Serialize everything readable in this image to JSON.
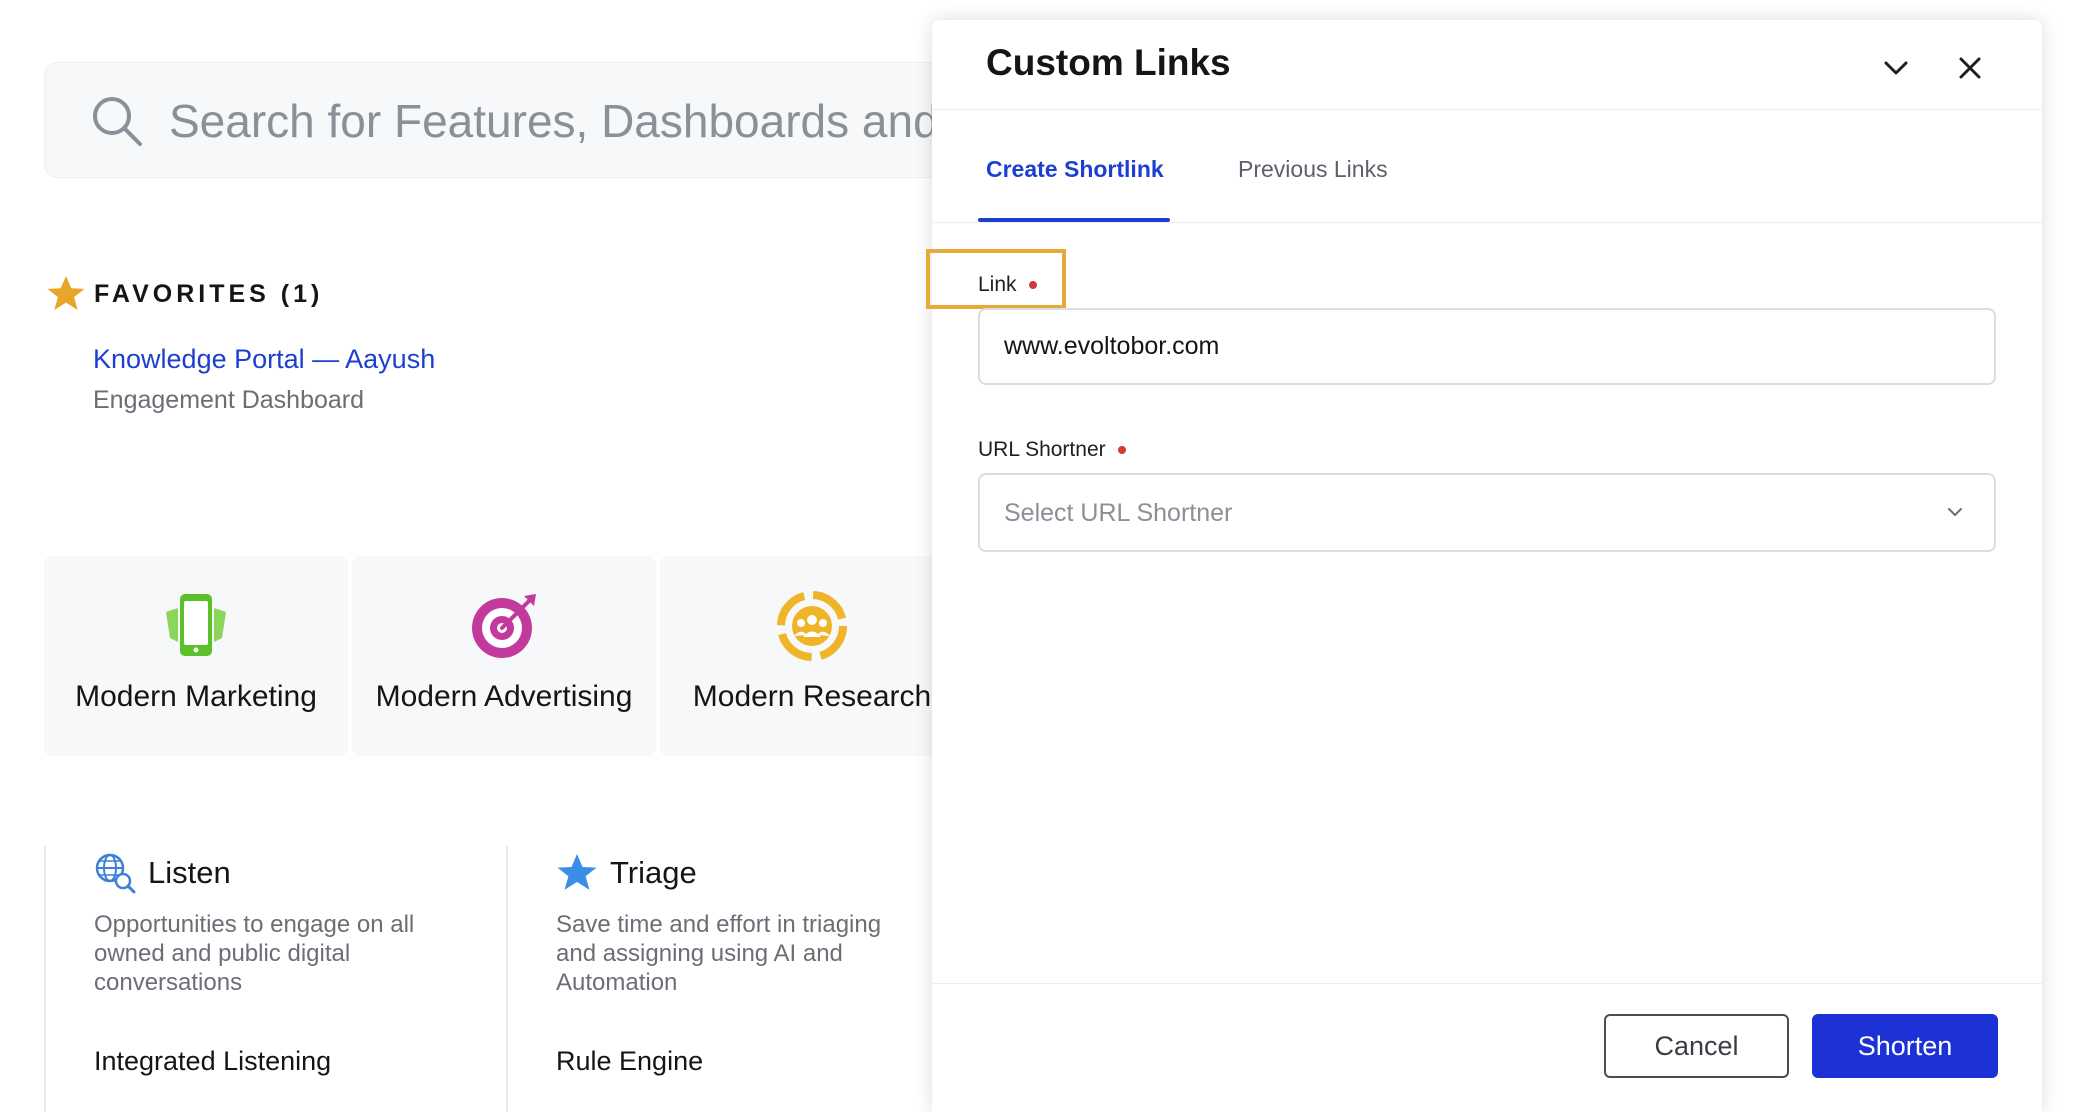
{
  "search": {
    "placeholder": "Search for Features, Dashboards and m"
  },
  "favorites": {
    "title": "FAVORITES (1)",
    "items": [
      {
        "name": "Knowledge Portal — Aayush",
        "subtitle": "Engagement Dashboard"
      }
    ]
  },
  "modules": [
    {
      "label": "Modern Marketing",
      "icon": "phone-icon"
    },
    {
      "label": "Modern Advertising",
      "icon": "target-icon"
    },
    {
      "label": "Modern Research",
      "icon": "research-icon"
    }
  ],
  "features": [
    {
      "title": "Listen",
      "icon": "globe-search-icon",
      "description": "Opportunities to engage on all owned and public digital conversations",
      "link": "Integrated Listening"
    },
    {
      "title": "Triage",
      "icon": "star-icon",
      "description": "Save time and effort in triaging and assigning using AI and Automation",
      "link": "Rule Engine"
    }
  ],
  "panel": {
    "title": "Custom Links",
    "tabs": [
      {
        "label": "Create Shortlink",
        "active": true
      },
      {
        "label": "Previous Links",
        "active": false
      }
    ],
    "link_field": {
      "label": "Link",
      "value": "www.evoltobor.com"
    },
    "shortner_field": {
      "label": "URL Shortner",
      "placeholder": "Select URL Shortner"
    },
    "cancel_label": "Cancel",
    "shorten_label": "Shorten"
  },
  "colors": {
    "accent_blue": "#1d3fd1",
    "button_blue": "#1d32d6",
    "highlight": "#e7a93a",
    "required": "#d33a3a",
    "favorite_star": "#e8a628",
    "marketing_green": "#5cc02a",
    "advertising_magenta": "#c23a9b",
    "research_yellow": "#f0b428"
  }
}
